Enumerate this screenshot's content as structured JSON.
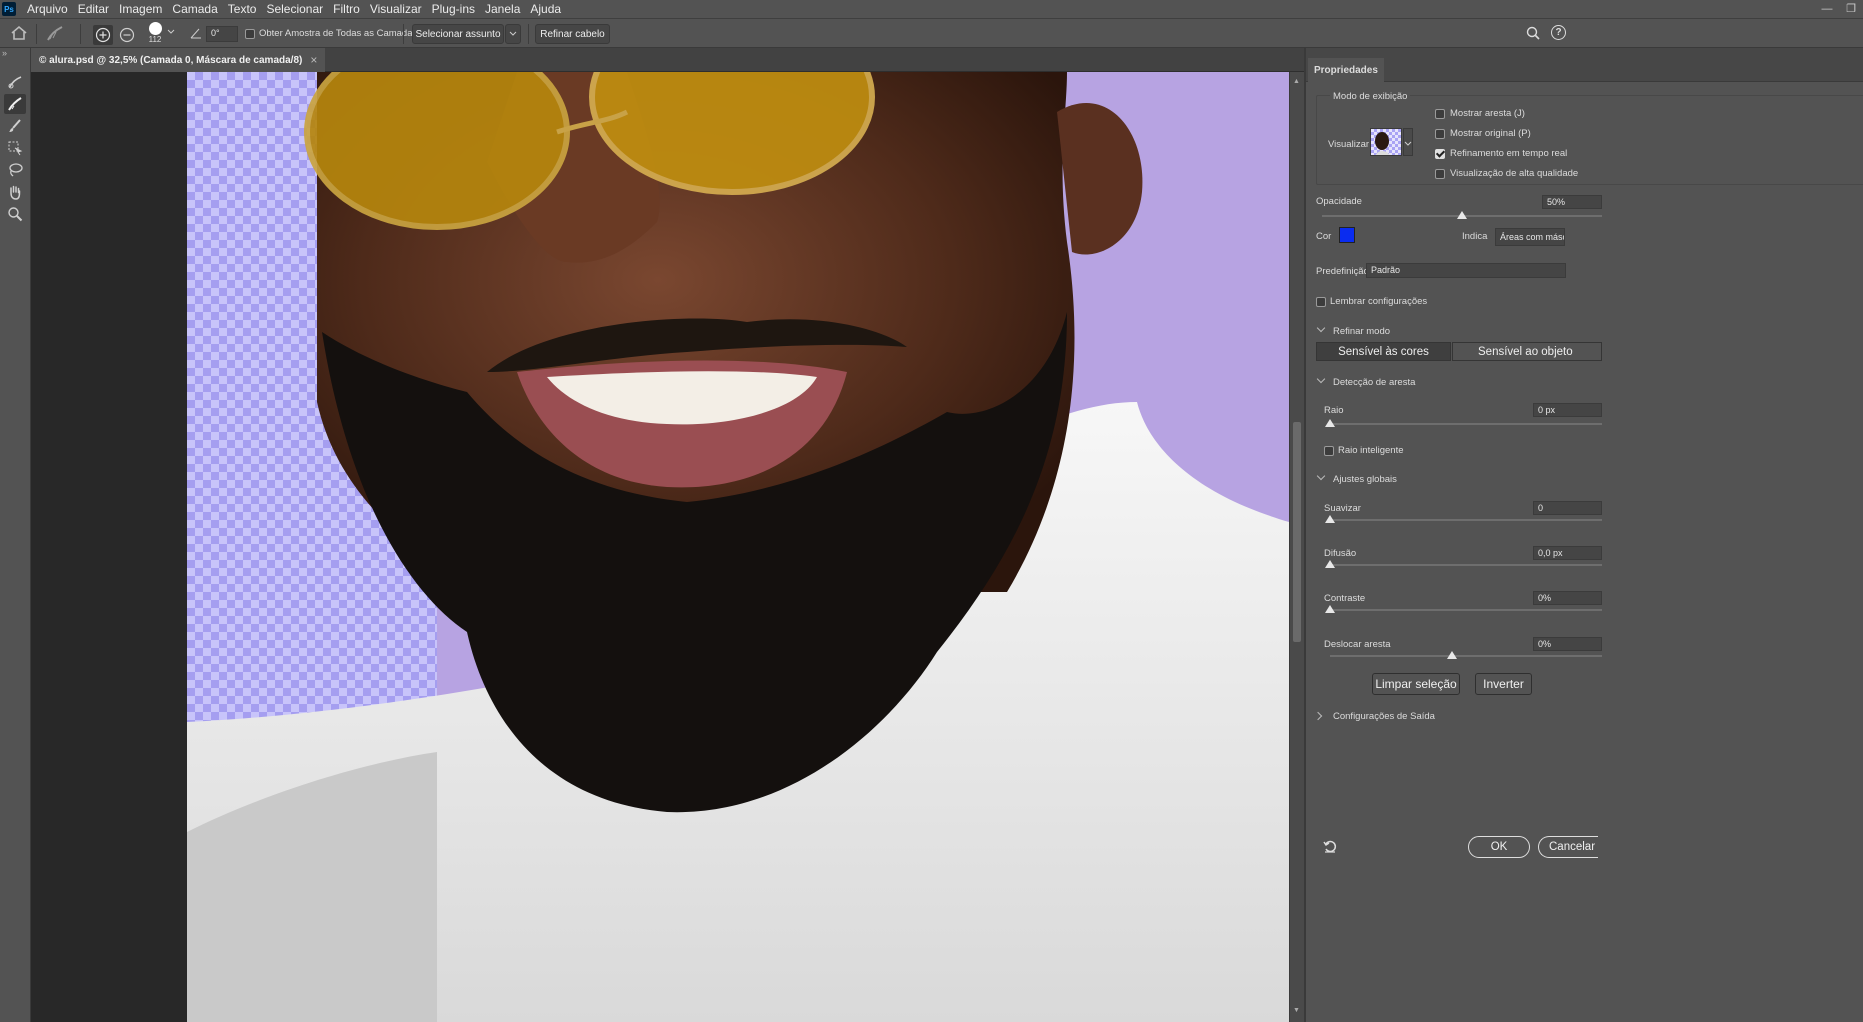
{
  "app": {
    "logo": "Ps"
  },
  "menu": [
    "Arquivo",
    "Editar",
    "Imagem",
    "Camada",
    "Texto",
    "Selecionar",
    "Filtro",
    "Visualizar",
    "Plug-ins",
    "Janela",
    "Ajuda"
  ],
  "options": {
    "brush_size": "112",
    "angle": "0°",
    "sample_all_layers": "Obter Amostra de Todas as Camadas",
    "select_subject": "Selecionar assunto",
    "refine_hair": "Refinar cabelo"
  },
  "document": {
    "tab_title": "© alura.psd @ 32,5% (Camada 0, Máscara de camada/8)",
    "close": "×"
  },
  "properties": {
    "panel_title": "Propriedades",
    "view_mode": {
      "label": "Modo de exibição",
      "preview_label": "Visualizar",
      "show_edge": "Mostrar aresta (J)",
      "show_original": "Mostrar original (P)",
      "realtime": "Refinamento em tempo real",
      "high_quality": "Visualização de alta qualidade"
    },
    "opacity": {
      "label": "Opacidade",
      "value": "50%",
      "level": 0.5
    },
    "color": {
      "label": "Cor",
      "swatch": "#0a2cf0",
      "indicates_label": "Indica",
      "indicates_value": "Áreas com máscara"
    },
    "preset": {
      "label": "Predefinição",
      "value": "Padrão"
    },
    "remember": "Lembrar configurações",
    "refine_mode": {
      "label": "Refinar modo",
      "color_aware": "Sensível às cores",
      "object_aware": "Sensível ao objeto"
    },
    "edge_detection": {
      "label": "Detecção de aresta",
      "radius_label": "Raio",
      "radius_value": "0 px",
      "smart_radius": "Raio inteligente"
    },
    "global": {
      "label": "Ajustes globais",
      "smooth_label": "Suavizar",
      "smooth_value": "0",
      "feather_label": "Difusão",
      "feather_value": "0,0 px",
      "contrast_label": "Contraste",
      "contrast_value": "0%",
      "shift_label": "Deslocar aresta",
      "shift_value": "0%"
    },
    "clear_selection": "Limpar seleção",
    "invert": "Inverter",
    "output": "Configurações de Saída",
    "ok": "OK",
    "cancel": "Cancelar"
  }
}
